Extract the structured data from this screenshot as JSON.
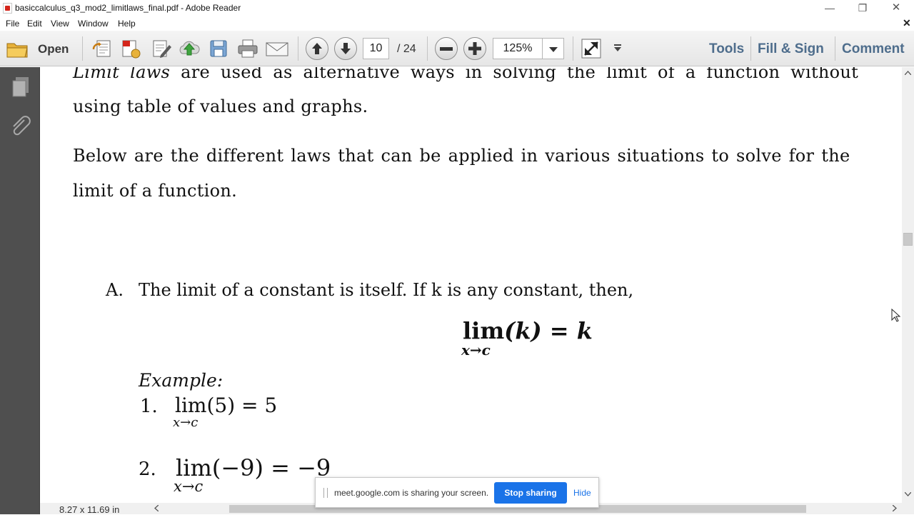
{
  "window": {
    "title": "basiccalculus_q3_mod2_limitlaws_final.pdf - Adobe Reader",
    "minimize": "—",
    "restore": "❐",
    "close": "✕"
  },
  "menu": {
    "items": [
      "File",
      "Edit",
      "View",
      "Window",
      "Help"
    ],
    "close_doc": "✕"
  },
  "toolbar": {
    "open_label": "Open",
    "page_current": "10",
    "page_total": "/  24",
    "zoom": "125%",
    "right_buttons": [
      "Tools",
      "Fill & Sign",
      "Comment"
    ],
    "icons": [
      "open-folder-icon",
      "create-pdf-icon",
      "export-pdf-icon",
      "edit-icon",
      "upload-icon",
      "save-icon",
      "print-icon",
      "email-icon",
      "prev-page-icon",
      "next-page-icon",
      "zoom-out-icon",
      "zoom-in-icon",
      "fit-page-icon"
    ],
    "link_color": "#4e6d8c"
  },
  "document": {
    "para1_line1_italic": "Limit laws",
    "para1_line1_rest": " are used as alternative ways in solving the limit of a function without",
    "para1_line2": "using table of values and graphs.",
    "para2_line1": "Below are the different laws that can be applied in various situations to solve for the",
    "para2_line2": "limit of a function.",
    "law_a_letter": "A.",
    "law_a_text": "The limit of a constant is itself. If k is any constant, then,",
    "formula_lim": "lim",
    "formula_rest": "(k) = k",
    "formula_sub": "x→c",
    "example_label": "Example:",
    "examples": [
      {
        "num": "1.",
        "formula": "lim(5) = 5",
        "sub": "x→c"
      },
      {
        "num": "2.",
        "formula": "lim(−9) = −9",
        "sub": "x→c"
      }
    ]
  },
  "status": {
    "page_size": "8.27 x 11.69 in"
  },
  "share_banner": {
    "text": "meet.google.com is sharing your screen.",
    "stop_label": "Stop sharing",
    "hide_label": "Hide",
    "button_color": "#1a73e8"
  }
}
